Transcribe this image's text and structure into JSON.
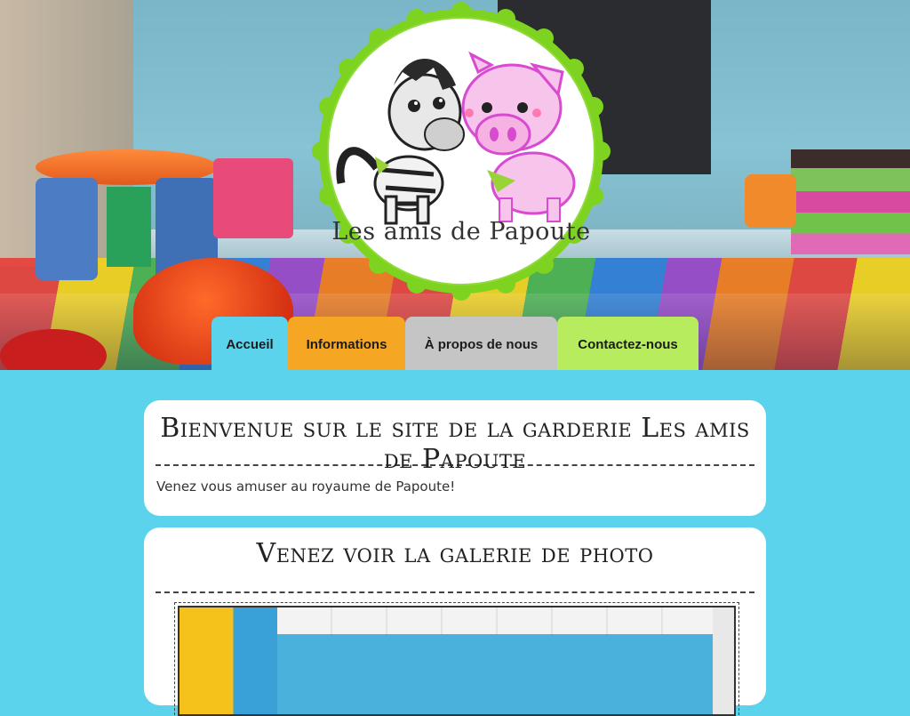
{
  "site": {
    "logo_text": "Les amis de Papoute"
  },
  "nav": {
    "items": [
      {
        "label": "Accueil",
        "color": "#5bd3ec",
        "active": true
      },
      {
        "label": "Informations",
        "color": "#f5a623"
      },
      {
        "label": "À propos de nous",
        "color": "#c5c5c5"
      },
      {
        "label": "Contactez-nous",
        "color": "#b6ec5e"
      }
    ]
  },
  "welcome": {
    "title": "Bienvenue sur le site de la garderie Les amis de Papoute",
    "text": "Venez vous amuser au royaume de Papoute!"
  },
  "gallery": {
    "title": "Venez voir la galerie de photo"
  },
  "colors": {
    "page_background": "#5bd3ec",
    "logo_ring": "#7ed321",
    "card_background": "#ffffff"
  },
  "icons": [
    "zebra-illustration",
    "pig-illustration"
  ]
}
